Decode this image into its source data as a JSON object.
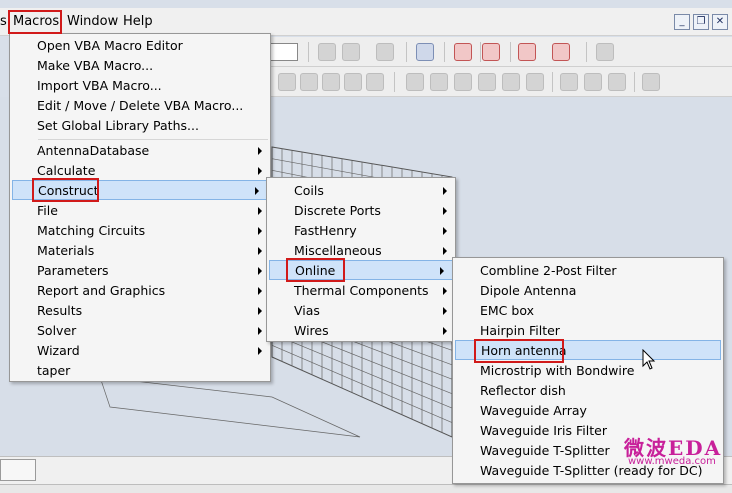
{
  "menubar": {
    "items": [
      "s",
      "Macros",
      "Window",
      "Help"
    ]
  },
  "window_controls": [
    "minimize-icon",
    "restore-icon",
    "close-icon"
  ],
  "macros_menu": {
    "group1": [
      "Open VBA Macro Editor",
      "Make VBA Macro...",
      "Import VBA Macro...",
      "Edit / Move / Delete VBA Macro...",
      "Set Global Library Paths..."
    ],
    "group2": [
      "AntennaDatabase",
      "Calculate",
      "Construct",
      "File",
      "Matching Circuits",
      "Materials",
      "Parameters",
      "Report and Graphics",
      "Results",
      "Solver",
      "Wizard",
      "taper"
    ],
    "highlighted": "Construct"
  },
  "construct_menu": {
    "items": [
      "Coils",
      "Discrete Ports",
      "FastHenry",
      "Miscellaneous",
      "Online",
      "Thermal Components",
      "Vias",
      "Wires"
    ],
    "highlighted": "Online"
  },
  "online_menu": {
    "items": [
      "Combline 2-Post Filter",
      "Dipole Antenna",
      "EMC box",
      "Hairpin Filter",
      "Horn antenna",
      "Microstrip with Bondwire",
      "Reflector dish",
      "Waveguide Array",
      "Waveguide Iris Filter",
      "Waveguide T-Splitter",
      "Waveguide T-Splitter (ready for DC)"
    ],
    "highlighted": "Horn antenna"
  },
  "watermark": {
    "title": "微波EDA",
    "url": "www.mweda.com"
  },
  "colors": {
    "highlight_bg": "#cfe3f9",
    "highlight_border": "#84b4e6",
    "annotation_red": "#d11a1a",
    "watermark": "#c8209a"
  }
}
